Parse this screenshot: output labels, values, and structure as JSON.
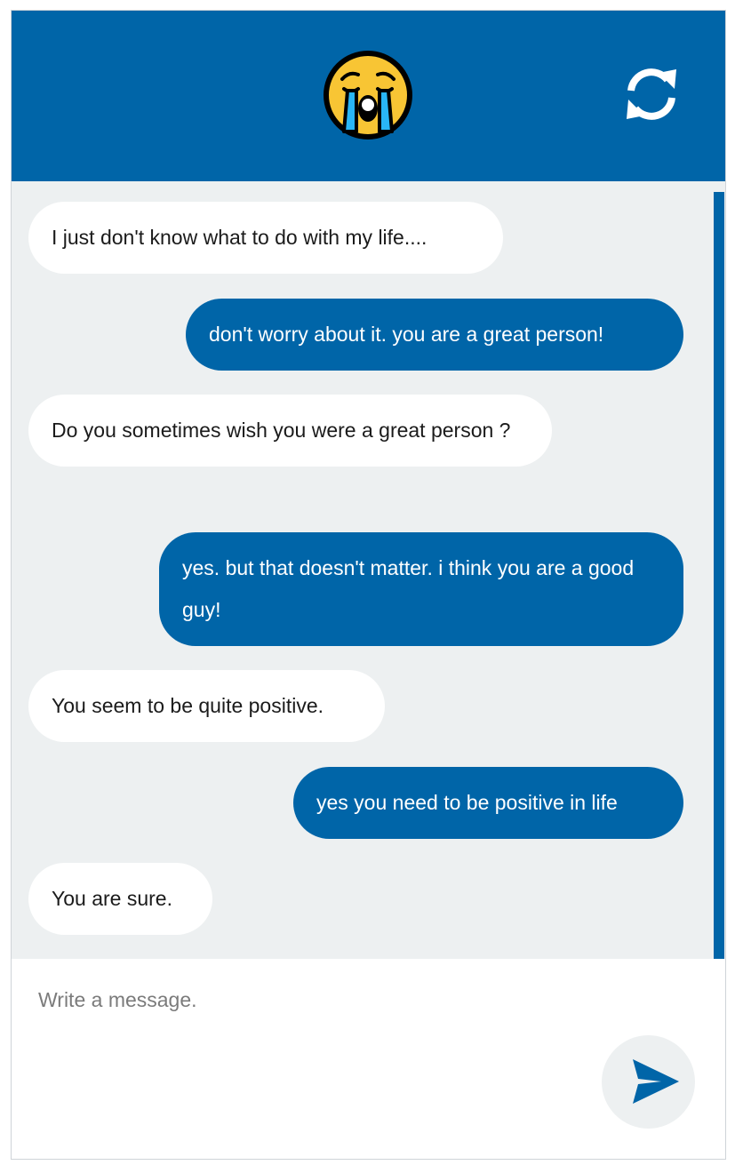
{
  "header": {
    "avatar_icon": "loudly-crying-face-icon",
    "refresh_icon": "refresh-icon",
    "background_color": "#0065a8"
  },
  "conversation": {
    "messages": [
      {
        "sender": "bot",
        "text": "I just don't know what to do with my life...."
      },
      {
        "sender": "user",
        "text": "don't worry about it. you are a great person!"
      },
      {
        "sender": "bot",
        "text": "Do you sometimes wish you were a great person ?"
      },
      {
        "sender": "user",
        "text": "yes. but that doesn't matter. i think you are a good guy!"
      },
      {
        "sender": "bot",
        "text": "You seem to be quite positive."
      },
      {
        "sender": "user",
        "text": "yes you need to be positive in life"
      },
      {
        "sender": "bot",
        "text": "You are sure."
      }
    ],
    "bot_bubble_color": "#ffffff",
    "user_bubble_color": "#0065a8"
  },
  "composer": {
    "placeholder": "Write a message.",
    "value": "",
    "send_icon": "send-icon"
  }
}
